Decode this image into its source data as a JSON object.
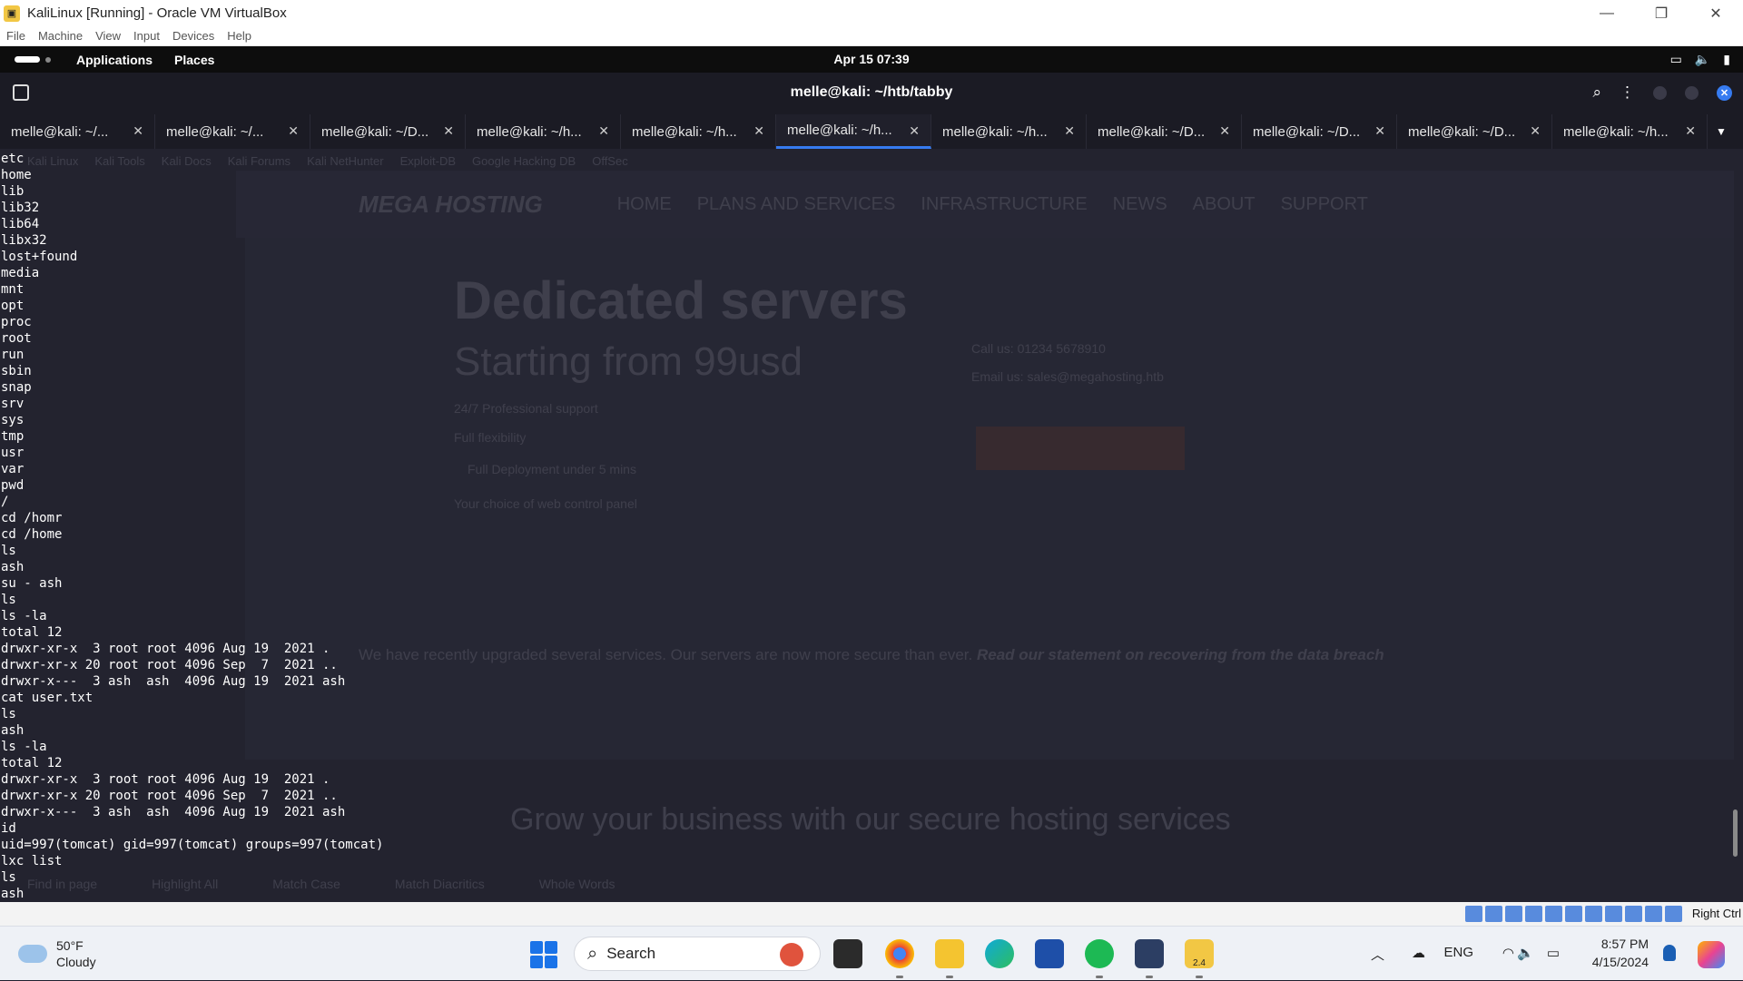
{
  "vbox": {
    "title": "KaliLinux [Running] - Oracle VM VirtualBox",
    "menu": [
      "File",
      "Machine",
      "View",
      "Input",
      "Devices",
      "Help"
    ],
    "host_key": "Right Ctrl"
  },
  "kali_panel": {
    "menus": [
      "Applications",
      "Places"
    ],
    "clock": "Apr 15  07:39"
  },
  "terminal": {
    "title": "melle@kali: ~/htb/tabby",
    "active_tab": 5,
    "tabs": [
      "melle@kali: ~/...",
      "melle@kali: ~/...",
      "melle@kali: ~/D...",
      "melle@kali: ~/h...",
      "melle@kali: ~/h...",
      "melle@kali: ~/h...",
      "melle@kali: ~/h...",
      "melle@kali: ~/D...",
      "melle@kali: ~/D...",
      "melle@kali: ~/D...",
      "melle@kali: ~/h..."
    ],
    "lines": [
      "etc",
      "home",
      "lib",
      "lib32",
      "lib64",
      "libx32",
      "lost+found",
      "media",
      "mnt",
      "opt",
      "proc",
      "root",
      "run",
      "sbin",
      "snap",
      "srv",
      "sys",
      "tmp",
      "usr",
      "var",
      "pwd",
      "/",
      "cd /homr",
      "cd /home",
      "ls",
      "ash",
      "su - ash",
      "ls",
      "ls -la",
      "total 12",
      "drwxr-xr-x  3 root root 4096 Aug 19  2021 .",
      "drwxr-xr-x 20 root root 4096 Sep  7  2021 ..",
      "drwxr-x---  3 ash  ash  4096 Aug 19  2021 ash",
      "cat user.txt",
      "ls",
      "ash",
      "ls -la",
      "total 12",
      "drwxr-xr-x  3 root root 4096 Aug 19  2021 .",
      "drwxr-xr-x 20 root root 4096 Sep  7  2021 ..",
      "drwxr-x---  3 ash  ash  4096 Aug 19  2021 ash",
      "id",
      "uid=997(tomcat) gid=997(tomcat) groups=997(tomcat)",
      "lxc list",
      "ls",
      "ash"
    ]
  },
  "background_page": {
    "bookmarks": [
      "Kali Linux",
      "Kali Tools",
      "Kali Docs",
      "Kali Forums",
      "Kali NetHunter",
      "Exploit-DB",
      "Google Hacking DB",
      "OffSec"
    ],
    "logo": "MEGA HOSTING",
    "nav": [
      "HOME",
      "PLANS AND SERVICES",
      "INFRASTRUCTURE",
      "NEWS",
      "ABOUT",
      "SUPPORT"
    ],
    "hero_title": "Dedicated servers",
    "hero_subtitle": "Starting from 99usd",
    "phone": "Call us: 01234 5678910",
    "email": "Email us: sales@megahosting.htb",
    "feature_1": "24/7 Professional support",
    "feature_2": "Full flexibility",
    "feature_3": "Full Deployment under 5 mins",
    "feature_4": "Your choice of web control panel",
    "notice": "We have recently upgraded several services. Our servers are now more secure than ever.",
    "notice_link": "Read our statement on recovering from the data breach",
    "tagline": "Grow your business with our secure hosting services",
    "find_bar": [
      "Find in page",
      "Highlight All",
      "Match Case",
      "Match Diacritics",
      "Whole Words"
    ]
  },
  "taskbar": {
    "weather_temp": "50°F",
    "weather_desc": "Cloudy",
    "search_label": "Search",
    "language": "ENG",
    "time": "8:57 PM",
    "date": "4/15/2024",
    "vbox_badge": "2.4"
  },
  "colors": {
    "terminal_bg": "#23232f",
    "accent": "#367bf0",
    "taskbar_bg": "#eef1f6"
  }
}
